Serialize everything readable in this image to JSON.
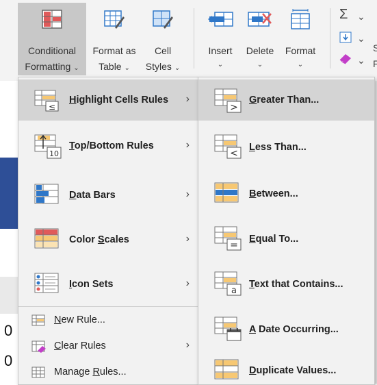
{
  "ribbon": {
    "conditional_formatting": {
      "line1": "Conditional",
      "line2": "Formatting",
      "chev": "⌄"
    },
    "format_as_table": {
      "line1": "Format as",
      "line2": "Table",
      "chev": "⌄"
    },
    "cell_styles": {
      "line1": "Cell",
      "line2": "Styles",
      "chev": "⌄"
    },
    "insert": {
      "line1": "Insert",
      "chev": "⌄"
    },
    "delete": {
      "line1": "Delete",
      "chev": "⌄"
    },
    "format": {
      "line1": "Format",
      "chev": "⌄"
    },
    "editing": {
      "sigma": "Σ",
      "chev": "⌄",
      "partial1": "S",
      "partial2": "F"
    }
  },
  "sheet": {
    "digit1": "0",
    "digit2": "0"
  },
  "menu": {
    "items": [
      {
        "label_u": "H",
        "label_rest": "ighlight Cells Rules",
        "arrow": "›"
      },
      {
        "label_u": "T",
        "label_rest": "op/Bottom Rules",
        "arrow": "›"
      },
      {
        "label_u": "D",
        "label_rest": "ata Bars",
        "arrow": "›"
      },
      {
        "label_pre": "Color ",
        "label_u": "S",
        "label_rest": "cales",
        "arrow": "›"
      },
      {
        "label_u": "I",
        "label_rest": "con Sets",
        "arrow": "›"
      }
    ],
    "new_rule": {
      "label_u": "N",
      "label_rest": "ew Rule..."
    },
    "clear_rules": {
      "label_u": "C",
      "label_rest": "lear Rules",
      "arrow": "›"
    },
    "manage_rules": {
      "label_pre": "Manage ",
      "label_u": "R",
      "label_rest": "ules..."
    }
  },
  "submenu": {
    "items": [
      {
        "label_u": "G",
        "label_rest": "reater Than...",
        "icon_glyph": ">"
      },
      {
        "label_u": "L",
        "label_rest": "ess Than...",
        "icon_glyph": "<"
      },
      {
        "label_u": "B",
        "label_rest": "etween...",
        "icon_glyph": ""
      },
      {
        "label_u": "E",
        "label_rest": "qual To...",
        "icon_glyph": "="
      },
      {
        "label_u": "T",
        "label_rest": "ext that Contains...",
        "icon_glyph": "a"
      },
      {
        "label_u": "A",
        "label_rest": " Date Occurring...",
        "icon_glyph": ""
      },
      {
        "label_u": "D",
        "label_rest": "uplicate Values...",
        "icon_glyph": ""
      }
    ]
  },
  "colors": {
    "accent_red": "#e05a5a",
    "accent_blue": "#2f77c8",
    "accent_yellow": "#f7c873",
    "highlight": "#d4d4d4"
  }
}
